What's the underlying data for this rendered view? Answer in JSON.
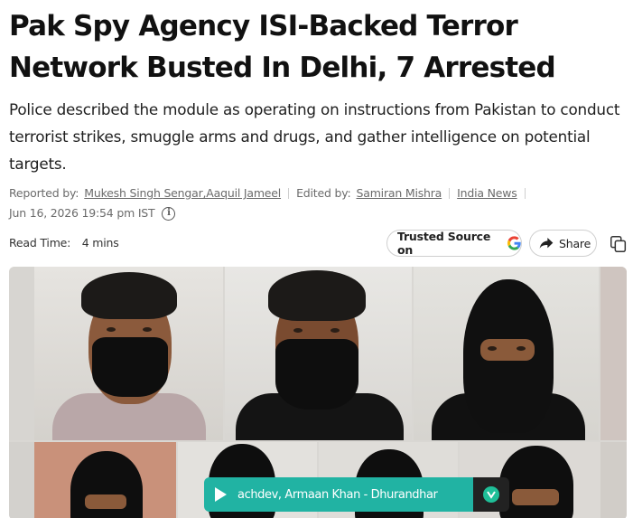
{
  "article": {
    "headline": "Pak Spy Agency ISI-Backed Terror Network Busted In Delhi, 7 Arrested",
    "summary": "Police described the module as operating on instructions from Pakistan to conduct terrorist strikes, smuggle arms and drugs, and gather intelligence on potential targets."
  },
  "meta": {
    "reported_by_label": "Reported by:",
    "reporter": "Mukesh Singh Sengar,Aaquil Jameel",
    "edited_by_label": "Edited by:",
    "editor": "Samiran Mishra",
    "category": "India News",
    "timestamp": "Jun 16, 2026 19:54 pm IST",
    "info_icon": "info-icon"
  },
  "toolbar": {
    "read_time_label": "Read Time:",
    "read_time_value": "4 mins",
    "trusted_label_prefix": "Trusted Source on",
    "trusted_icon": "google-g-icon",
    "share_label": "Share",
    "share_icon": "share-arrow-icon",
    "copy_icon": "copy-icon"
  },
  "video_player": {
    "title": "achdev, Armaan Khan - Dhurandhar",
    "play_icon": "play-icon",
    "logo_icon": "brand-logo-icon",
    "accent_color": "#21b3a3"
  }
}
